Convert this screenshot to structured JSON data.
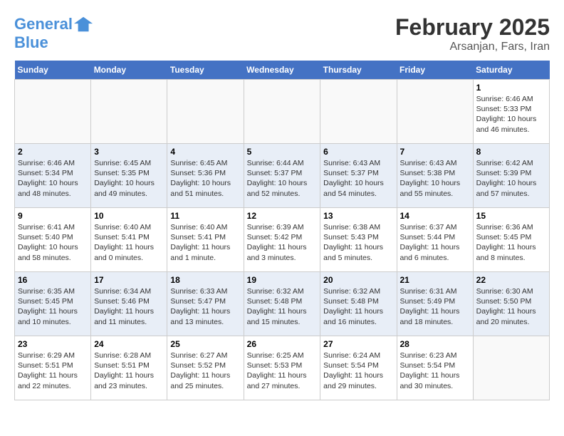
{
  "logo": {
    "line1": "General",
    "line2": "Blue"
  },
  "title": "February 2025",
  "subtitle": "Arsanjan, Fars, Iran",
  "weekdays": [
    "Sunday",
    "Monday",
    "Tuesday",
    "Wednesday",
    "Thursday",
    "Friday",
    "Saturday"
  ],
  "weeks": [
    [
      {
        "day": "",
        "info": ""
      },
      {
        "day": "",
        "info": ""
      },
      {
        "day": "",
        "info": ""
      },
      {
        "day": "",
        "info": ""
      },
      {
        "day": "",
        "info": ""
      },
      {
        "day": "",
        "info": ""
      },
      {
        "day": "1",
        "info": "Sunrise: 6:46 AM\nSunset: 5:33 PM\nDaylight: 10 hours and 46 minutes."
      }
    ],
    [
      {
        "day": "2",
        "info": "Sunrise: 6:46 AM\nSunset: 5:34 PM\nDaylight: 10 hours and 48 minutes."
      },
      {
        "day": "3",
        "info": "Sunrise: 6:45 AM\nSunset: 5:35 PM\nDaylight: 10 hours and 49 minutes."
      },
      {
        "day": "4",
        "info": "Sunrise: 6:45 AM\nSunset: 5:36 PM\nDaylight: 10 hours and 51 minutes."
      },
      {
        "day": "5",
        "info": "Sunrise: 6:44 AM\nSunset: 5:37 PM\nDaylight: 10 hours and 52 minutes."
      },
      {
        "day": "6",
        "info": "Sunrise: 6:43 AM\nSunset: 5:37 PM\nDaylight: 10 hours and 54 minutes."
      },
      {
        "day": "7",
        "info": "Sunrise: 6:43 AM\nSunset: 5:38 PM\nDaylight: 10 hours and 55 minutes."
      },
      {
        "day": "8",
        "info": "Sunrise: 6:42 AM\nSunset: 5:39 PM\nDaylight: 10 hours and 57 minutes."
      }
    ],
    [
      {
        "day": "9",
        "info": "Sunrise: 6:41 AM\nSunset: 5:40 PM\nDaylight: 10 hours and 58 minutes."
      },
      {
        "day": "10",
        "info": "Sunrise: 6:40 AM\nSunset: 5:41 PM\nDaylight: 11 hours and 0 minutes."
      },
      {
        "day": "11",
        "info": "Sunrise: 6:40 AM\nSunset: 5:41 PM\nDaylight: 11 hours and 1 minute."
      },
      {
        "day": "12",
        "info": "Sunrise: 6:39 AM\nSunset: 5:42 PM\nDaylight: 11 hours and 3 minutes."
      },
      {
        "day": "13",
        "info": "Sunrise: 6:38 AM\nSunset: 5:43 PM\nDaylight: 11 hours and 5 minutes."
      },
      {
        "day": "14",
        "info": "Sunrise: 6:37 AM\nSunset: 5:44 PM\nDaylight: 11 hours and 6 minutes."
      },
      {
        "day": "15",
        "info": "Sunrise: 6:36 AM\nSunset: 5:45 PM\nDaylight: 11 hours and 8 minutes."
      }
    ],
    [
      {
        "day": "16",
        "info": "Sunrise: 6:35 AM\nSunset: 5:45 PM\nDaylight: 11 hours and 10 minutes."
      },
      {
        "day": "17",
        "info": "Sunrise: 6:34 AM\nSunset: 5:46 PM\nDaylight: 11 hours and 11 minutes."
      },
      {
        "day": "18",
        "info": "Sunrise: 6:33 AM\nSunset: 5:47 PM\nDaylight: 11 hours and 13 minutes."
      },
      {
        "day": "19",
        "info": "Sunrise: 6:32 AM\nSunset: 5:48 PM\nDaylight: 11 hours and 15 minutes."
      },
      {
        "day": "20",
        "info": "Sunrise: 6:32 AM\nSunset: 5:48 PM\nDaylight: 11 hours and 16 minutes."
      },
      {
        "day": "21",
        "info": "Sunrise: 6:31 AM\nSunset: 5:49 PM\nDaylight: 11 hours and 18 minutes."
      },
      {
        "day": "22",
        "info": "Sunrise: 6:30 AM\nSunset: 5:50 PM\nDaylight: 11 hours and 20 minutes."
      }
    ],
    [
      {
        "day": "23",
        "info": "Sunrise: 6:29 AM\nSunset: 5:51 PM\nDaylight: 11 hours and 22 minutes."
      },
      {
        "day": "24",
        "info": "Sunrise: 6:28 AM\nSunset: 5:51 PM\nDaylight: 11 hours and 23 minutes."
      },
      {
        "day": "25",
        "info": "Sunrise: 6:27 AM\nSunset: 5:52 PM\nDaylight: 11 hours and 25 minutes."
      },
      {
        "day": "26",
        "info": "Sunrise: 6:25 AM\nSunset: 5:53 PM\nDaylight: 11 hours and 27 minutes."
      },
      {
        "day": "27",
        "info": "Sunrise: 6:24 AM\nSunset: 5:54 PM\nDaylight: 11 hours and 29 minutes."
      },
      {
        "day": "28",
        "info": "Sunrise: 6:23 AM\nSunset: 5:54 PM\nDaylight: 11 hours and 30 minutes."
      },
      {
        "day": "",
        "info": ""
      }
    ]
  ]
}
